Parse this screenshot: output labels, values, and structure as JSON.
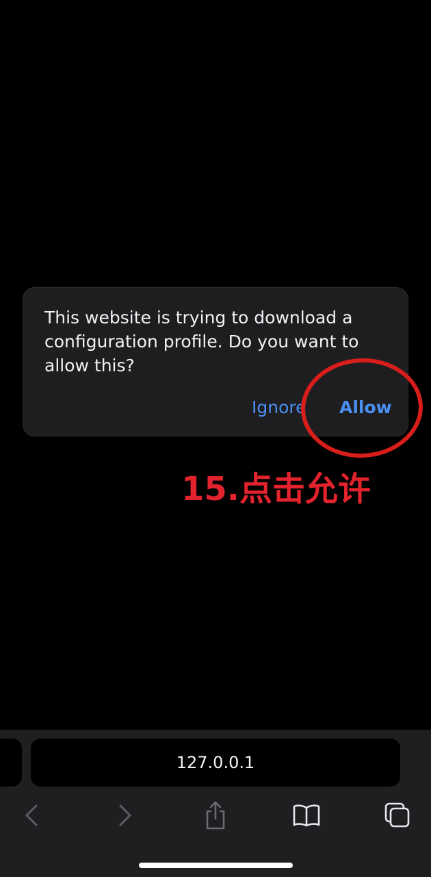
{
  "alert": {
    "message": "This website is trying to download a configuration profile. Do you want to allow this?",
    "ignore_label": "Ignore",
    "allow_label": "Allow"
  },
  "annotation": {
    "text": "15.点击允许"
  },
  "toolbar": {
    "address": "127.0.0.1",
    "icons": [
      "back-icon",
      "forward-icon",
      "share-icon",
      "bookmarks-icon",
      "tabs-icon"
    ]
  },
  "colors": {
    "alert_background": "#1e1e20",
    "link_blue": "#4a90f2",
    "annotation_red": "#d81e1b"
  }
}
